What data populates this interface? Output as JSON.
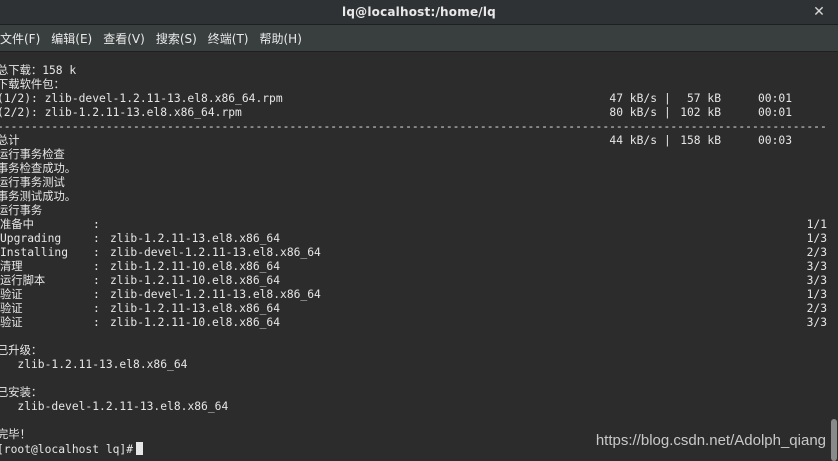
{
  "window": {
    "title": "lq@localhost:/home/lq",
    "close_glyph": "✕"
  },
  "menu": [
    "文件(F)",
    "编辑(E)",
    "查看(V)",
    "搜索(S)",
    "终端(T)",
    "帮助(H)"
  ],
  "terminal": {
    "total_download": "总下载：158 k",
    "downloading_header": "下载软件包：",
    "downloads": [
      {
        "name": "(1/2): zlib-devel-1.2.11-13.el8.x86_64.rpm",
        "speed": "47 kB/s",
        "sep": "|",
        "size": "57 kB",
        "time": "00:01"
      },
      {
        "name": "(2/2): zlib-1.2.11-13.el8.x86_64.rpm",
        "speed": "80 kB/s",
        "sep": "|",
        "size": "102 kB",
        "time": "00:01"
      }
    ],
    "divider": "--------------------------------------------------------------------------------------------------------------------------------",
    "total": {
      "name": "总计",
      "speed": "44 kB/s",
      "sep": "|",
      "size": "158 kB",
      "time": "00:03"
    },
    "check_lines": [
      "运行事务检查",
      "事务检查成功。",
      "运行事务测试",
      "事务测试成功。",
      "运行事务"
    ],
    "transaction": [
      {
        "stage": "准备中",
        "colon": ":",
        "pkg": "",
        "count": "1/1"
      },
      {
        "stage": "Upgrading",
        "colon": ":",
        "pkg": "zlib-1.2.11-13.el8.x86_64",
        "count": "1/3"
      },
      {
        "stage": "Installing",
        "colon": ":",
        "pkg": "zlib-devel-1.2.11-13.el8.x86_64",
        "count": "2/3"
      },
      {
        "stage": "清理",
        "colon": ":",
        "pkg": "zlib-1.2.11-10.el8.x86_64",
        "count": "3/3"
      },
      {
        "stage": "运行脚本",
        "colon": ":",
        "pkg": "zlib-1.2.11-10.el8.x86_64",
        "count": "3/3"
      },
      {
        "stage": "验证",
        "colon": ":",
        "pkg": "zlib-devel-1.2.11-13.el8.x86_64",
        "count": "1/3"
      },
      {
        "stage": "验证",
        "colon": ":",
        "pkg": "zlib-1.2.11-13.el8.x86_64",
        "count": "2/3"
      },
      {
        "stage": "验证",
        "colon": ":",
        "pkg": "zlib-1.2.11-10.el8.x86_64",
        "count": "3/3"
      }
    ],
    "upgraded_header": "已升级：",
    "upgraded_pkg": "zlib-1.2.11-13.el8.x86_64",
    "installed_header": "已安装：",
    "installed_pkg": "zlib-devel-1.2.11-13.el8.x86_64",
    "complete": "完毕！",
    "prompt": "[root@localhost lq]#"
  },
  "watermark": "https://blog.csdn.net/Adolph_qiang"
}
